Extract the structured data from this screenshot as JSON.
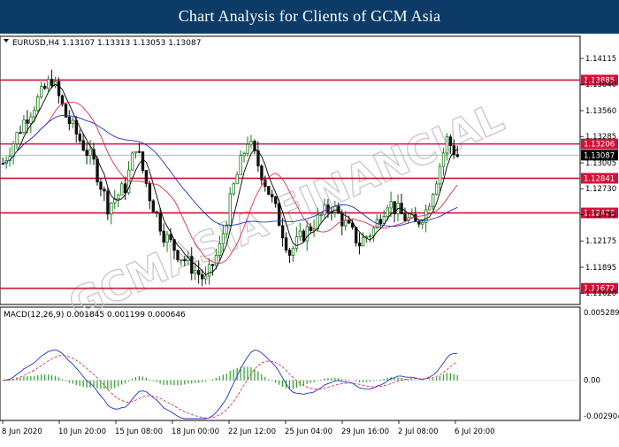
{
  "header": {
    "title": "Chart Analysis for Clients of GCM Asia"
  },
  "main_chart": {
    "info_line": "EURUSD,H4  1.13107 1.13313 1.13053 1.13087",
    "y_ticks": [
      "1.14115",
      "1.13840",
      "1.13560",
      "1.13285",
      "1.13005",
      "1.12730",
      "1.12455",
      "1.12175",
      "1.11895",
      "1.11620"
    ],
    "levels": [
      "1.13885",
      "1.13206",
      "1.12841",
      "1.12473",
      "1.11672"
    ],
    "current_price": "1.13087",
    "level_color": "#d4103a"
  },
  "macd": {
    "info_line": "MACD(12,26,9) 0.001845 0.001199 0.000646",
    "y_ticks": [
      "0.005289",
      "0.00",
      "-0.002904"
    ]
  },
  "x_axis": {
    "labels": [
      "8 Jun 2020",
      "10 Jun 20:00",
      "15 Jun 08:00",
      "18 Jun 00:00",
      "22 Jun 12:00",
      "25 Jun 04:00",
      "29 Jun 16:00",
      "2 Jul 08:00",
      "6 Jul 20:00"
    ]
  },
  "watermark": {
    "text": "GCMASIA FINANCIAL"
  },
  "colors": {
    "header_bg": "#0b3b66",
    "bull": "#1a7a1a",
    "bear": "#111111",
    "ma_red": "#e0304a",
    "ma_blue": "#2030c8",
    "macd_hist": "#22a022"
  }
}
